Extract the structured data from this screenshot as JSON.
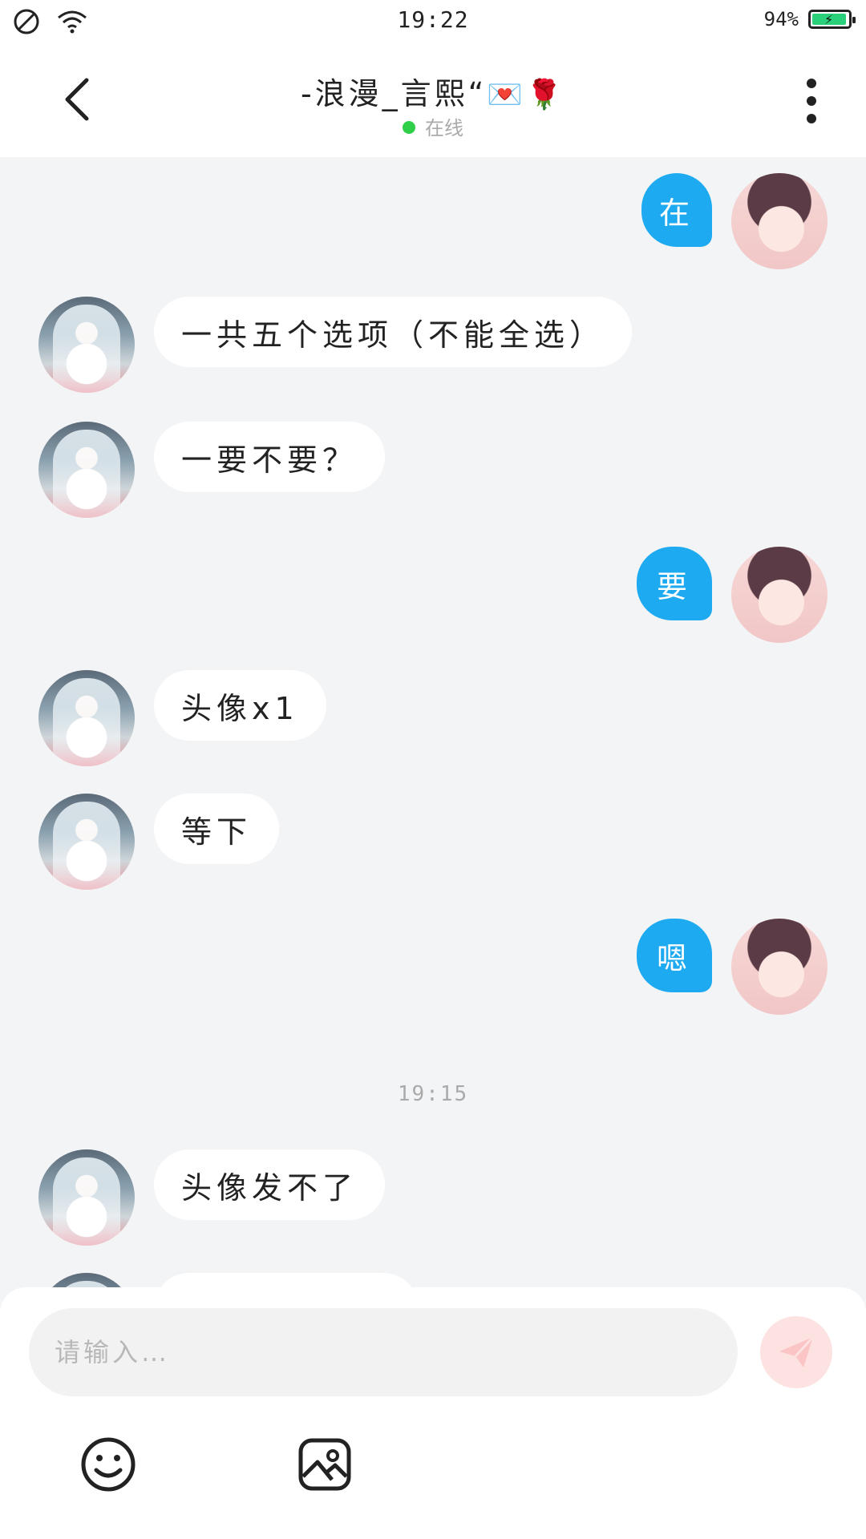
{
  "status_bar": {
    "time": "19:22",
    "battery": "94%",
    "battery_level": 0.94,
    "icons": [
      "do-not-disturb-icon",
      "wifi-icon",
      "battery-charging-icon"
    ]
  },
  "header": {
    "title_text": "-浪漫_言熙“",
    "title_emoji": "💌🌹",
    "status": "在线",
    "status_color": "#2fcf4a"
  },
  "messages": [
    {
      "side": "right",
      "text": "在"
    },
    {
      "side": "left",
      "text": "一共五个选项（不能全选）"
    },
    {
      "side": "left",
      "text": "一要不要？"
    },
    {
      "side": "right",
      "text": "要"
    },
    {
      "side": "left",
      "text": "头像x1"
    },
    {
      "side": "left",
      "text": "等下"
    },
    {
      "side": "right",
      "text": "嗯"
    },
    {
      "side": "left",
      "text": "头像发不了"
    }
  ],
  "timestamp": "19:15",
  "composer": {
    "placeholder": "请输入…",
    "send_color": "#fde2e2"
  },
  "colors": {
    "accent": "#1eaaf1",
    "background": "#f3f4f6"
  }
}
